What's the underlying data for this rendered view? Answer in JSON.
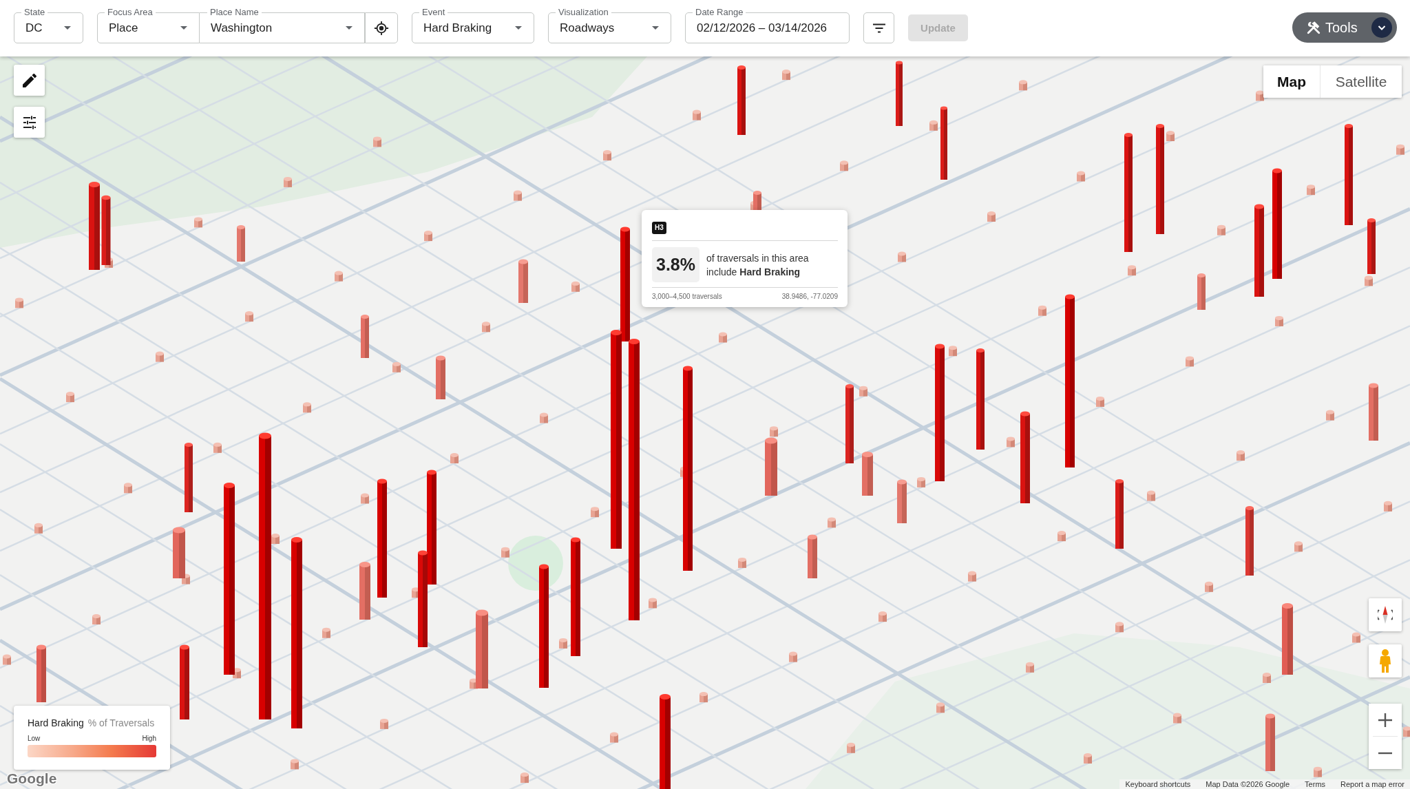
{
  "toolbar": {
    "controls": [
      {
        "kind": "select",
        "label": "State",
        "value": "DC"
      },
      {
        "kind": "select_group",
        "parts": [
          {
            "label": "Focus Area",
            "value": "Place"
          },
          {
            "label": "Place Name",
            "value": "Washington"
          }
        ]
      },
      {
        "kind": "select",
        "label": "Event",
        "value": "Hard Braking"
      },
      {
        "kind": "select",
        "label": "Visualization",
        "value": "Roadways"
      },
      {
        "kind": "date",
        "label": "Date Range",
        "value": "02/12/2026 – 03/14/2026"
      },
      {
        "kind": "filter_button"
      },
      {
        "kind": "button",
        "label": "Update",
        "disabled": true
      }
    ],
    "tools_button": {
      "label": "Tools"
    }
  },
  "map": {
    "view_toggle": [
      {
        "label": "Map",
        "selected": true
      },
      {
        "label": "Satellite",
        "selected": false
      }
    ],
    "tooltip": {
      "badge": "H3",
      "value": "3.8%",
      "description": "of traversals in this area include **Hard Braking**",
      "traversals": "3,000–4,500 traversals",
      "coordinates": "38.9486, -77.0209"
    },
    "legend": {
      "title": "Hard Braking",
      "unit": "% of Traversals",
      "low_label": "Low",
      "high_label": "High"
    },
    "logo": "Google",
    "attribution": [
      "Keyboard shortcuts",
      "Map Data ©2026 Google",
      "Terms",
      "Report a map error"
    ]
  }
}
